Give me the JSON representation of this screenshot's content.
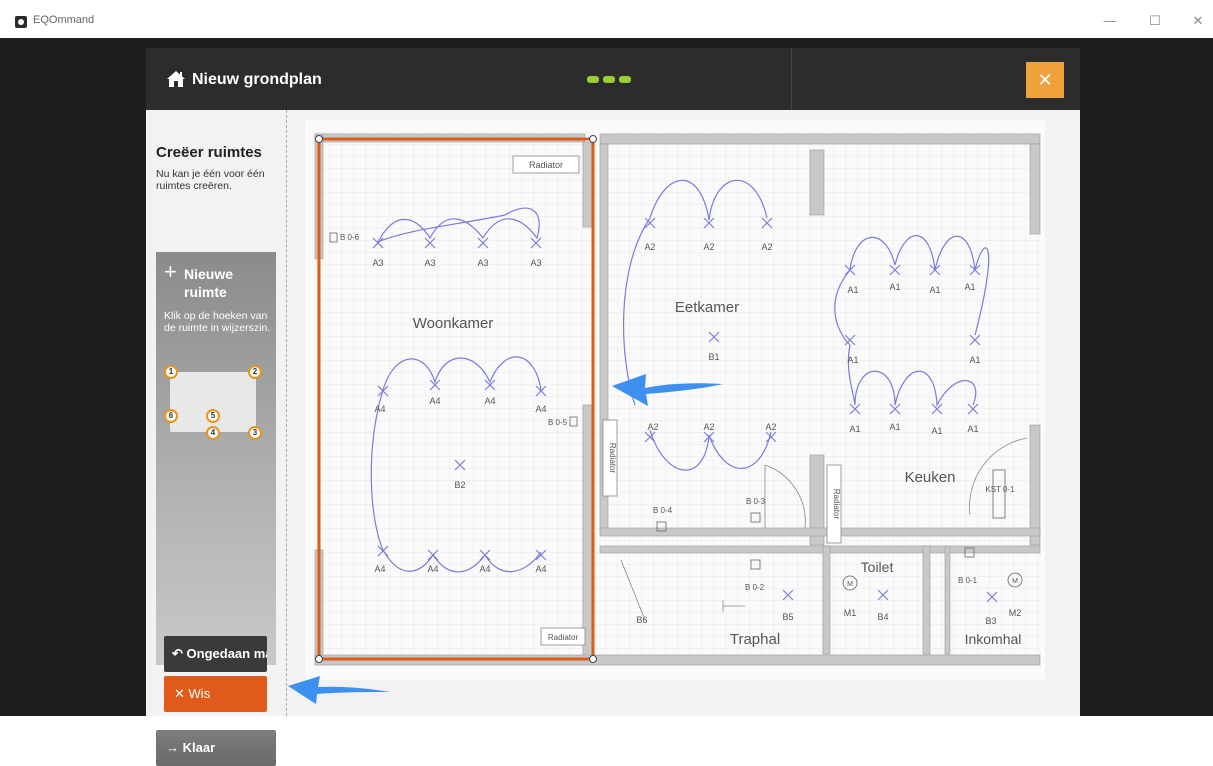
{
  "window": {
    "app_title": "EQOmmand",
    "minimize_symbol": "—",
    "maximize_symbol": "☐",
    "close_symbol": "✕"
  },
  "header": {
    "title": "Nieuw grondplan",
    "close_symbol": "✕",
    "progress_steps": 3
  },
  "sidebar": {
    "title": "Creëer ruimtes",
    "description": "Nu kan je één voor één ruimtes creëren.",
    "panel": {
      "plus_symbol": "+",
      "title": "Nieuwe ruimte",
      "instructions": "Klik op de hoeken van de ruimte in wijzerszin.",
      "corner_numbers": [
        "1",
        "2",
        "3",
        "4",
        "5",
        "6"
      ]
    },
    "undo_label": "Ongedaan maken",
    "undo_symbol": "↶",
    "wis_label": "Wis",
    "wis_symbol": "✕",
    "klaar_label": "Klaar",
    "klaar_symbol": "→"
  },
  "floorplan": {
    "rooms": {
      "woonkamer": "Woonkamer",
      "eetkamer": "Eetkamer",
      "keuken": "Keuken",
      "toilet": "Toilet",
      "traphal": "Traphal",
      "inkomhal": "Inkomhal"
    },
    "radiator_label": "Radiator",
    "switches": [
      "B 0-6",
      "B 0-5",
      "B 0-4",
      "B 0-3",
      "B 0-2",
      "B 0-1"
    ],
    "kst_label": "KST 0-1",
    "fixture_labels": {
      "A1": "A1",
      "A2": "A2",
      "A3": "A3",
      "A4": "A4",
      "B1": "B1",
      "B2": "B2",
      "B3": "B3",
      "B4": "B4",
      "B5": "B5",
      "B6": "B6",
      "M1": "M1",
      "M2": "M2",
      "M": "M"
    },
    "colors": {
      "selection": "#e05a1c",
      "wiring": "#7b7bdc",
      "arrow": "#3d8ff0"
    }
  }
}
